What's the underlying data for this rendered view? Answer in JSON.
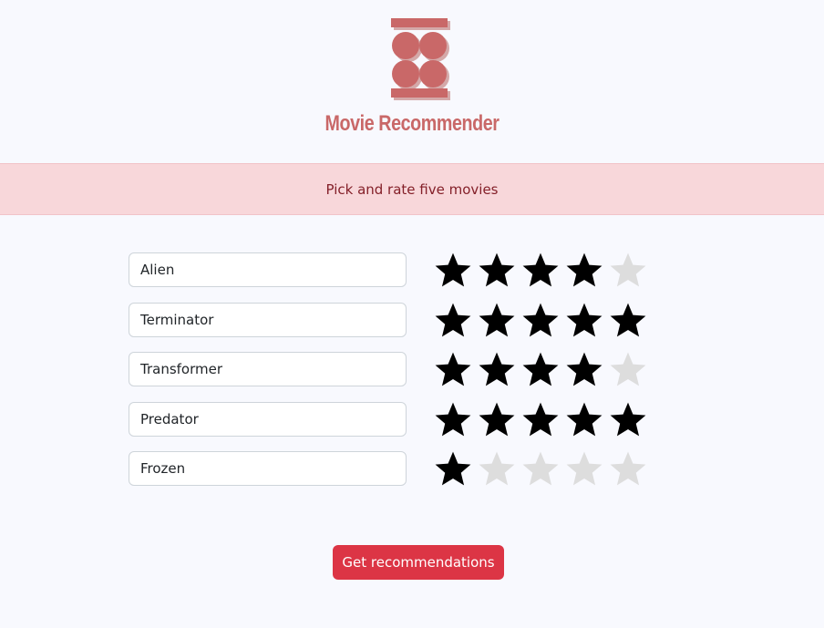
{
  "header": {
    "logo_icon": "film-reel-logo-icon",
    "title": "Movie Recommender",
    "brand_color": "#c96868"
  },
  "banner": {
    "text": "Pick and rate five movies"
  },
  "movies": [
    {
      "title": "Alien",
      "rating": 4
    },
    {
      "title": "Terminator",
      "rating": 5
    },
    {
      "title": "Transformer",
      "rating": 4
    },
    {
      "title": "Predator",
      "rating": 5
    },
    {
      "title": "Frozen",
      "rating": 1
    }
  ],
  "rating_max": 5,
  "colors": {
    "star_on": "#000000",
    "star_off": "#dddddd",
    "button": "#dc3545"
  },
  "actions": {
    "submit_label": "Get recommendations"
  }
}
